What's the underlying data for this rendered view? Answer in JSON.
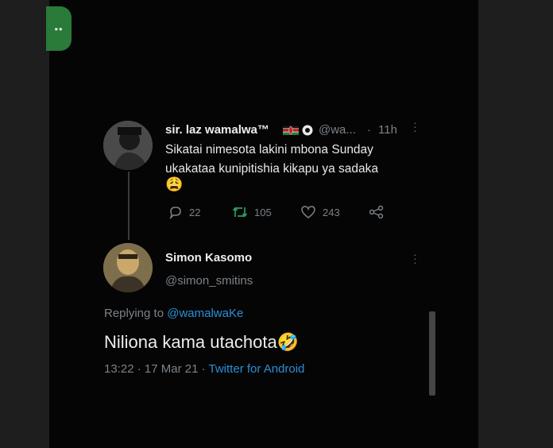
{
  "original_tweet": {
    "display_name": "sir. laz wamalwa™",
    "handle": "@wa...",
    "separator": "·",
    "time_ago": "11h",
    "text_line1": "Sikatai nimesota lakini mbona Sunday",
    "text_line2": "ukakataa kunipitishia kikapu ya sadaka",
    "emoji": "😩",
    "replies": "22",
    "retweets": "105",
    "likes": "243"
  },
  "reply_tweet": {
    "display_name": "Simon Kasomo",
    "handle": "@simon_smitins",
    "replying_prefix": "Replying to",
    "replying_handle": "@wamalwaKe",
    "text": "Niliona kama utachota",
    "emoji": "🤣",
    "time": "13:22",
    "date": "17 Mar 21",
    "source": "Twitter for Android"
  },
  "overlay": {
    "pill_text": "••"
  },
  "colors": {
    "background": "#050505",
    "link": "#2a8fd8",
    "muted": "#7b8288",
    "retweet_green": "#2e9e6a",
    "pill_green": "#2a7a3a"
  },
  "icons": [
    "reply-icon",
    "retweet-icon",
    "like-icon",
    "share-icon",
    "more-icon",
    "kenya-flag-icon",
    "badge-icon"
  ]
}
